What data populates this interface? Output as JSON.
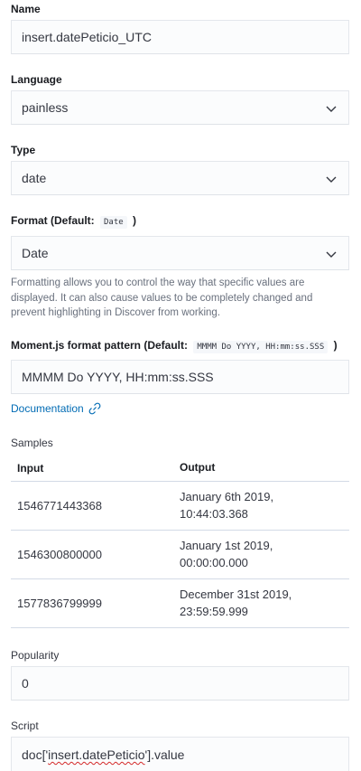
{
  "name": {
    "label": "Name",
    "value": "insert.datePeticio_UTC"
  },
  "language": {
    "label": "Language",
    "value": "painless"
  },
  "type": {
    "label": "Type",
    "value": "date"
  },
  "format": {
    "label_prefix": "Format (Default:",
    "default_code": "Date",
    "label_suffix": ")",
    "value": "Date",
    "help": "Formatting allows you to control the way that specific values are displayed. It can also cause values to be completely changed and prevent highlighting in Discover from working."
  },
  "moment": {
    "label_prefix": "Moment.js format pattern (Default:",
    "default_code": "MMMM Do YYYY, HH:mm:ss.SSS",
    "label_suffix": ")",
    "value": "MMMM Do YYYY, HH:mm:ss.SSS"
  },
  "documentation": {
    "label": "Documentation"
  },
  "samples": {
    "label": "Samples",
    "headers": {
      "input": "Input",
      "output": "Output"
    },
    "rows": [
      {
        "input": "1546771443368",
        "output_line1": "January 6th 2019,",
        "output_line2": "10:44:03.368"
      },
      {
        "input": "1546300800000",
        "output_line1": "January 1st 2019,",
        "output_line2": "00:00:00.000"
      },
      {
        "input": "1577836799999",
        "output_line1": "December 31st 2019,",
        "output_line2": "23:59:59.999"
      }
    ]
  },
  "popularity": {
    "label": "Popularity",
    "value": "0"
  },
  "script": {
    "label": "Script",
    "prefix": "doc['",
    "highlight": "insert.datePeticio",
    "suffix": "'].value"
  },
  "colors": {
    "link": "#006bb4",
    "label": "#1a1c21",
    "help": "#69707d",
    "field_bg": "#fbfcfd"
  }
}
